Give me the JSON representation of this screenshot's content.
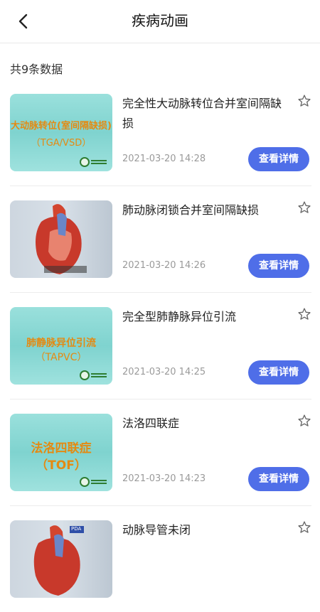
{
  "header": {
    "title": "疾病动画"
  },
  "summary": {
    "count_text": "共9条数据"
  },
  "items": [
    {
      "title": "完全性大动脉转位合并室间隔缺损",
      "time": "2021-03-20 14:28",
      "button": "查看详情",
      "thumb": {
        "kind": "text",
        "line1": "大动脉转位(室间隔缺损)",
        "line2": "（TGA/VSD）"
      }
    },
    {
      "title": "肺动脉闭锁合并室间隔缺损",
      "time": "2021-03-20 14:26",
      "button": "查看详情",
      "thumb": {
        "kind": "heart"
      }
    },
    {
      "title": "完全型肺静脉异位引流",
      "time": "2021-03-20 14:25",
      "button": "查看详情",
      "thumb": {
        "kind": "text",
        "line1": "肺静脉异位引流",
        "line2": "（TAPVC）"
      }
    },
    {
      "title": "法洛四联症",
      "time": "2021-03-20 14:23",
      "button": "查看详情",
      "thumb": {
        "kind": "text",
        "line1": "法洛四联症",
        "line2": "（TOF）"
      }
    },
    {
      "title": "动脉导管未闭",
      "time": "",
      "button": "",
      "thumb": {
        "kind": "heart",
        "tag": "PDA"
      }
    }
  ],
  "icons": {
    "back": "chevron-left-icon",
    "favorite": "star-outline-icon"
  },
  "colors": {
    "accent": "#4f6ee8",
    "thumb_text": "#e48a12",
    "thumb_bg": "#8ad8d4"
  }
}
